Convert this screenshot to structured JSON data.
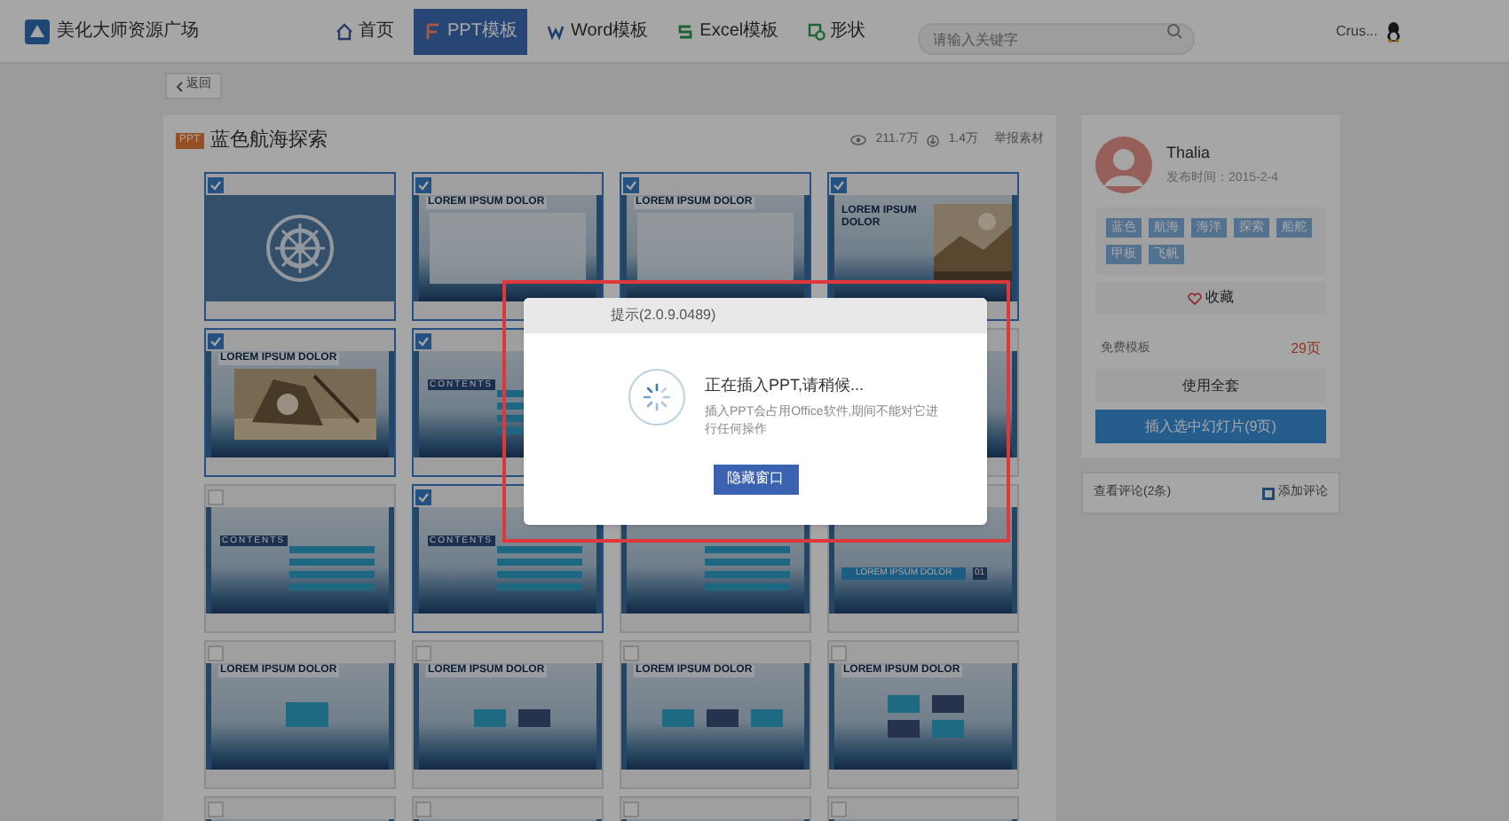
{
  "header": {
    "site_title": "美化大师资源广场",
    "nav": [
      {
        "kind": "home",
        "label": "首页",
        "selected": false
      },
      {
        "kind": "ppt",
        "label": "PPT模板",
        "selected": true
      },
      {
        "kind": "word",
        "label": "Word模板",
        "selected": false
      },
      {
        "kind": "excel",
        "label": "Excel模板",
        "selected": false
      },
      {
        "kind": "shape",
        "label": "形状",
        "selected": false
      }
    ],
    "search": {
      "placeholder": "请输入关键字"
    },
    "user": "Crus..."
  },
  "back_button": "返回",
  "template": {
    "badge": "PPT",
    "title": "蓝色航海探索",
    "views": "211.7万",
    "downloads": "1.4万",
    "report": "举报素材"
  },
  "slides": [
    {
      "kind": "wheel",
      "checked": true
    },
    {
      "kind": "text1",
      "title": "LOREM IPSUM DOLOR",
      "checked": true
    },
    {
      "kind": "text2",
      "title": "LOREM IPSUM DOLOR",
      "checked": true
    },
    {
      "kind": "phototext",
      "title": "LOREM IPSUM DOLOR",
      "checked": true
    },
    {
      "title": "LOREM IPSUM DOLOR",
      "checked": true
    },
    {
      "kind": "contents",
      "title": "CONTENTS",
      "checked": true
    },
    {
      "kind": "covered"
    },
    {
      "kind": "plain"
    },
    {
      "kind": "contents",
      "title": "CONTENTS",
      "checked": false
    },
    {
      "kind": "contents",
      "title": "CONTENTS",
      "checked": true
    },
    {
      "kind": "list"
    },
    {
      "kind": "numbered",
      "title": "LOREM IPSUM DOLOR",
      "number": "01"
    },
    {
      "kind": "boxes1",
      "title": "LOREM IPSUM DOLOR",
      "checked": false
    },
    {
      "kind": "boxes2",
      "title": "LOREM IPSUM DOLOR",
      "checked": false
    },
    {
      "kind": "boxes3",
      "title": "LOREM IPSUM DOLOR",
      "checked": false
    },
    {
      "kind": "boxes4",
      "title": "LOREM IPSUM DOLOR",
      "checked": false
    },
    {
      "kind": "plain",
      "checked": false
    },
    {
      "kind": "plain",
      "checked": false
    },
    {
      "kind": "plain",
      "checked": false
    },
    {
      "kind": "plain",
      "checked": false
    }
  ],
  "author": {
    "name": "Thalia",
    "published": "发布时间：2015-2-4",
    "tags": [
      "蓝色",
      "航海",
      "海洋",
      "探索",
      "船舵",
      "甲板",
      "飞帆"
    ],
    "favorite": "收藏",
    "free_label": "免费模板",
    "pages": "29页",
    "use_all": "使用全套",
    "insert_selected": "插入选中幻灯片(9页)"
  },
  "comments": {
    "view": "查看评论(2条)",
    "add": "添加评论"
  },
  "dialog": {
    "title": "提示(2.0.9.0489)",
    "message": "正在插入PPT,请稍候...",
    "detail": "插入PPT会占用Office软件,期间不能对它进行任何操作",
    "button": "隐藏窗口"
  }
}
